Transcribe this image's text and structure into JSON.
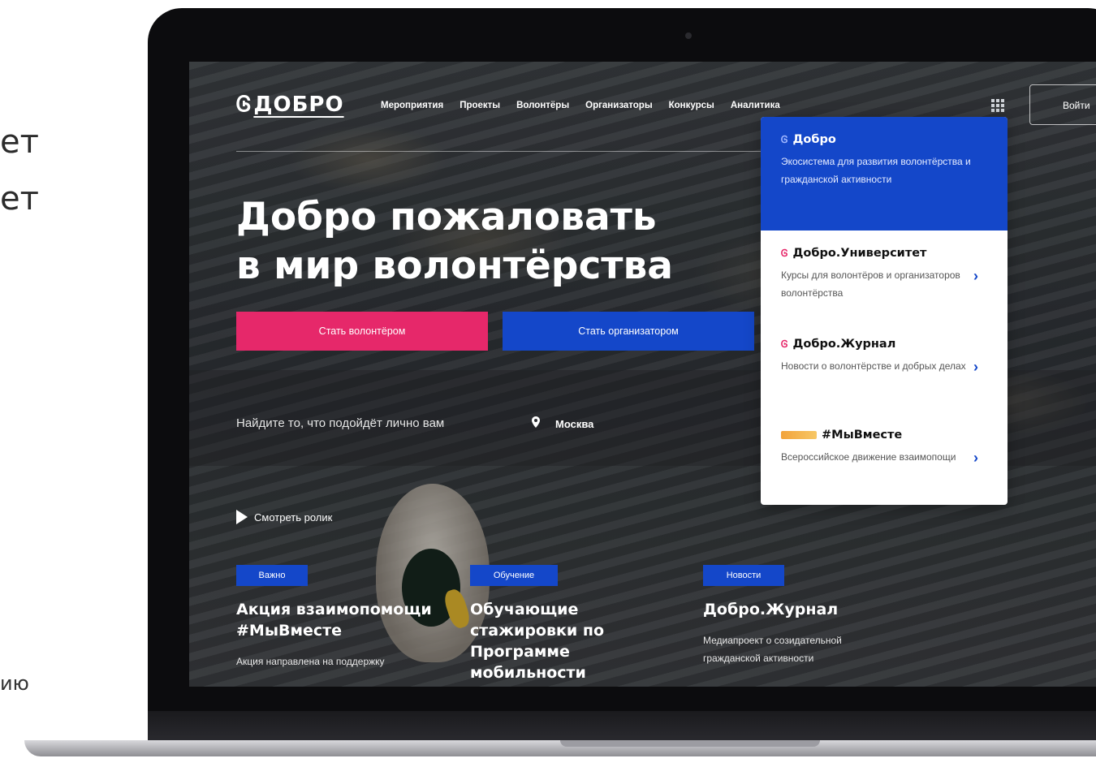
{
  "slide_fragments": {
    "line1": "ет",
    "line2": "ет",
    "line3": "ию"
  },
  "site": {
    "logo": "ДОБРО",
    "nav": [
      "Мероприятия",
      "Проекты",
      "Волонтёры",
      "Организаторы",
      "Конкурсы",
      "Аналитика"
    ],
    "login_label": "Войти",
    "hero_title_line1": "Добро пожаловать",
    "hero_title_line2": "в мир волонтёрства",
    "btn_volunteer": "Стать волонтёром",
    "btn_organizer": "Стать организатором",
    "search_prompt": "Найдите то, что подойдёт лично вам",
    "city": "Москва",
    "watch_video": "Смотреть ролик",
    "cards": [
      {
        "badge": "Важно",
        "title": "Акция взаимопомощи #МыВместе",
        "desc": "Акция направлена на поддержку"
      },
      {
        "badge": "Обучение",
        "title": "Обучающие стажировки по Программе мобильности",
        "desc": ""
      },
      {
        "badge": "Новости",
        "title": "Добро.Журнал",
        "desc": "Медиапроект о созидательной гражданской активности"
      }
    ]
  },
  "dropdown": {
    "header": {
      "title": "Добро",
      "desc": "Экосистема для развития волонтёрства и гражданской активности"
    },
    "items": [
      {
        "title": "Добро.Университет",
        "desc": "Курсы для волонтёров и организаторов волонтёрства"
      },
      {
        "title": "Добро.Журнал",
        "desc": "Новости о волонтёрстве и добрых делах"
      },
      {
        "title": "#МыВместе",
        "desc": "Всероссийское движение взаимопощи"
      }
    ]
  },
  "colors": {
    "accent_pink": "#e6286a",
    "accent_blue": "#1447c9"
  }
}
